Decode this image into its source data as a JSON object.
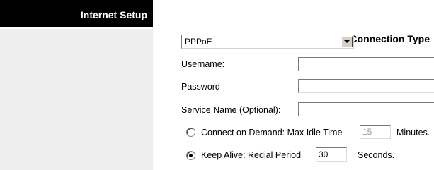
{
  "sidebar": {
    "section_title": "Internet Setup",
    "subsection_title": "Internet Connection Type"
  },
  "connection_type": {
    "selected": "PPPoE"
  },
  "form": {
    "username_label": "Username:",
    "username_value": "",
    "password_label": "Password",
    "password_value": "",
    "service_name_label": "Service Name (Optional):",
    "service_name_value": "",
    "connect_on_demand": {
      "label": "Connect on Demand: Max Idle Time",
      "value": "15",
      "unit": "Minutes.",
      "selected": false
    },
    "keep_alive": {
      "label": "Keep Alive: Redial Period",
      "value": "30",
      "unit": "Seconds.",
      "selected": true
    }
  },
  "colors": {
    "sidebar_header_bg": "#000000",
    "sidebar_bg": "#eeeeee",
    "content_bg": "#ffffff"
  }
}
